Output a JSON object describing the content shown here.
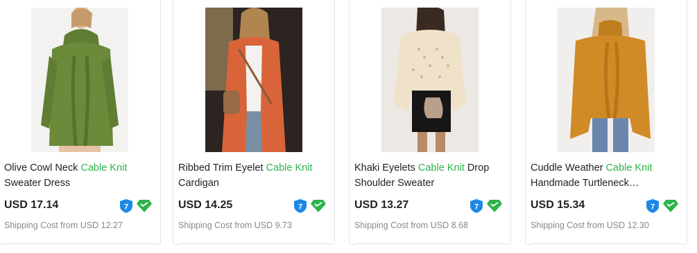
{
  "products": [
    {
      "title_before": "Olive Cowl Neck ",
      "title_highlight": "Cable Knit",
      "title_after": " Sweater Dress",
      "price": "USD 17.14",
      "shipping": "Shipping Cost from USD 12.27",
      "badge_number": "7",
      "image_desc": "olive-green-cowl-neck-sweater-dress"
    },
    {
      "title_before": "Ribbed Trim Eyelet ",
      "title_highlight": "Cable Knit",
      "title_after": " Cardigan",
      "price": "USD 14.25",
      "shipping": "Shipping Cost from USD 9.73",
      "badge_number": "7",
      "image_desc": "orange-knit-cardigan"
    },
    {
      "title_before": "Khaki Eyelets ",
      "title_highlight": "Cable Knit",
      "title_after": " Drop Shoulder Sweater",
      "price": "USD 13.27",
      "shipping": "Shipping Cost from USD 8.68",
      "badge_number": "7",
      "image_desc": "khaki-off-shoulder-sweater"
    },
    {
      "title_before": "Cuddle Weather ",
      "title_highlight": "Cable Knit",
      "title_after": " Handmade Turtleneck…",
      "price": "USD 15.34",
      "shipping": "Shipping Cost from USD 12.30",
      "badge_number": "7",
      "image_desc": "mustard-turtleneck-sweater"
    }
  ],
  "colors": {
    "highlight": "#2fb24c",
    "shield": "#1e88e5",
    "diamond": "#2fb24c"
  }
}
